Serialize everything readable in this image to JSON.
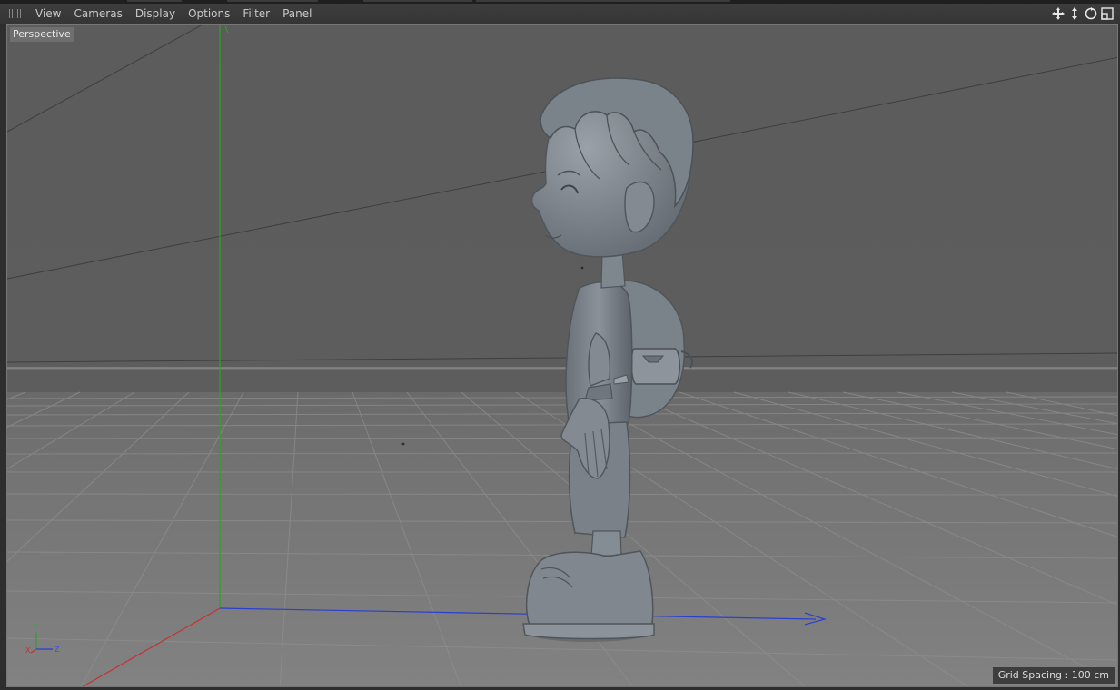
{
  "menubar": {
    "items": [
      "View",
      "Cameras",
      "Display",
      "Options",
      "Filter",
      "Panel"
    ]
  },
  "nav_icons": [
    "move-view-icon",
    "dolly-view-icon",
    "rotate-view-icon",
    "maximize-view-icon"
  ],
  "viewport": {
    "camera_label": "Perspective",
    "grid_spacing": "Grid Spacing : 100 cm",
    "gizmo": {
      "y": "Y",
      "x": "X",
      "z": "Z"
    }
  },
  "colors": {
    "viewport_bg": "#5b5b5b",
    "floor": "#7a7a7a",
    "x_axis": "#c83030",
    "y_axis": "#2ea02e",
    "z_axis": "#2a3fd0",
    "model": "#7d858c"
  }
}
